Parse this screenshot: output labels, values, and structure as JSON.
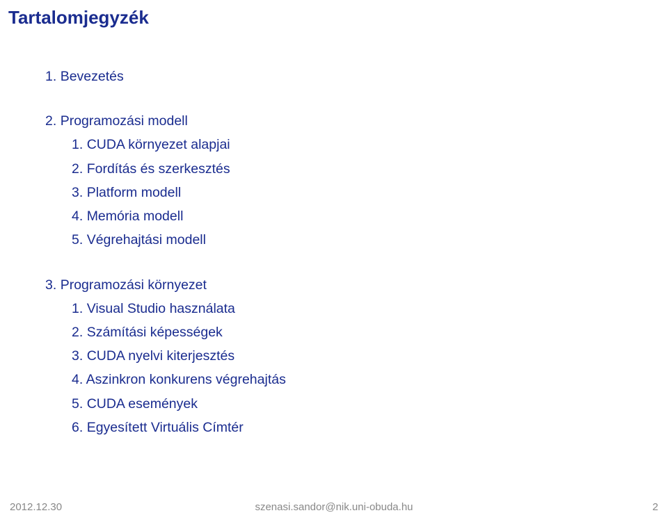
{
  "title": "Tartalomjegyzék",
  "toc": {
    "s1": {
      "num": "1.",
      "label": "Bevezetés"
    },
    "s2": {
      "num": "2.",
      "label": "Programozási modell",
      "i1": {
        "num": "1.",
        "label": "CUDA környezet alapjai"
      },
      "i2": {
        "num": "2.",
        "label": "Fordítás és szerkesztés"
      },
      "i3": {
        "num": "3.",
        "label": "Platform modell"
      },
      "i4": {
        "num": "4.",
        "label": "Memória modell"
      },
      "i5": {
        "num": "5.",
        "label": "Végrehajtási modell"
      }
    },
    "s3": {
      "num": "3.",
      "label": "Programozási környezet",
      "i1": {
        "num": "1.",
        "label": "Visual Studio használata"
      },
      "i2": {
        "num": "2.",
        "label": "Számítási képességek"
      },
      "i3": {
        "num": "3.",
        "label": "CUDA nyelvi kiterjesztés"
      },
      "i4": {
        "num": "4.",
        "label": "Aszinkron konkurens végrehajtás"
      },
      "i5": {
        "num": "5.",
        "label": "CUDA események"
      },
      "i6": {
        "num": "6.",
        "label": "Egyesített Virtuális Címtér"
      }
    }
  },
  "footer": {
    "date": "2012.12.30",
    "email": "szenasi.sandor@nik.uni-obuda.hu",
    "page": "2"
  }
}
